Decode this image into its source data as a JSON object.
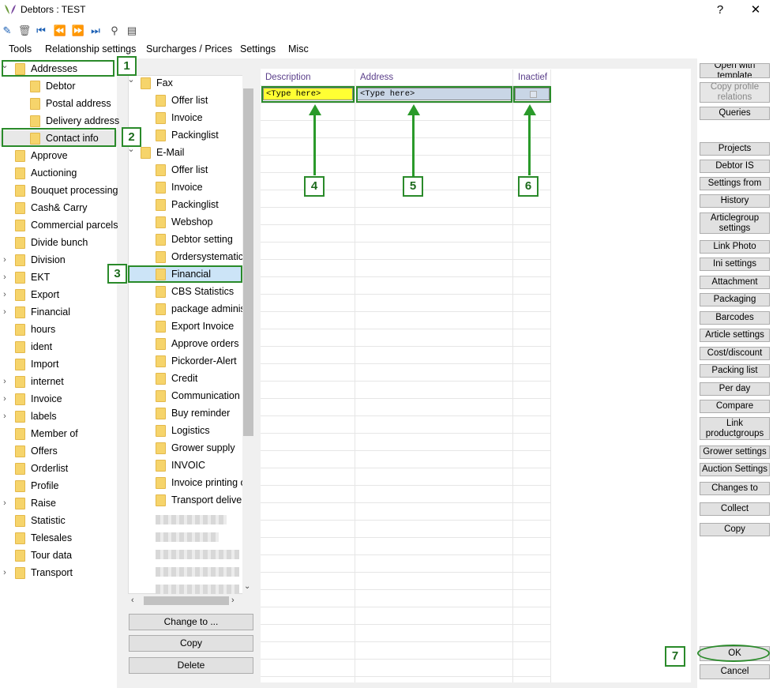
{
  "window": {
    "title": "Debtors : TEST",
    "help_label": "?",
    "close_label": "✕"
  },
  "toolbar": {
    "icons": [
      "edit-icon",
      "trash-icon",
      "first-icon",
      "prev-icon",
      "next-icon",
      "last-icon",
      "search-icon",
      "notes-icon"
    ]
  },
  "menu": [
    "Tools",
    "Relationship settings",
    "Surcharges / Prices",
    "Settings",
    "Misc"
  ],
  "left_tree": [
    {
      "label": "Addresses",
      "chev": "⌄",
      "indent": 0
    },
    {
      "label": "Debtor",
      "chev": "",
      "indent": 1
    },
    {
      "label": "Postal address",
      "chev": "",
      "indent": 1
    },
    {
      "label": "Delivery address",
      "chev": "",
      "indent": 1
    },
    {
      "label": "Contact info",
      "chev": "",
      "indent": 1
    },
    {
      "label": "Approve",
      "chev": "",
      "indent": 0
    },
    {
      "label": "Auctioning",
      "chev": "",
      "indent": 0
    },
    {
      "label": "Bouquet processing",
      "chev": "",
      "indent": 0
    },
    {
      "label": "Cash& Carry",
      "chev": "",
      "indent": 0
    },
    {
      "label": "Commercial parcels",
      "chev": "",
      "indent": 0
    },
    {
      "label": "Divide bunch",
      "chev": "",
      "indent": 0
    },
    {
      "label": "Division",
      "chev": "›",
      "indent": 0
    },
    {
      "label": "EKT",
      "chev": "›",
      "indent": 0
    },
    {
      "label": "Export",
      "chev": "›",
      "indent": 0
    },
    {
      "label": "Financial",
      "chev": "›",
      "indent": 0
    },
    {
      "label": "hours",
      "chev": "",
      "indent": 0
    },
    {
      "label": "ident",
      "chev": "",
      "indent": 0
    },
    {
      "label": "Import",
      "chev": "",
      "indent": 0
    },
    {
      "label": "internet",
      "chev": "›",
      "indent": 0
    },
    {
      "label": "Invoice",
      "chev": "›",
      "indent": 0
    },
    {
      "label": "labels",
      "chev": "›",
      "indent": 0
    },
    {
      "label": "Member of",
      "chev": "",
      "indent": 0
    },
    {
      "label": "Offers",
      "chev": "",
      "indent": 0
    },
    {
      "label": "Orderlist",
      "chev": "",
      "indent": 0
    },
    {
      "label": "Profile",
      "chev": "",
      "indent": 0
    },
    {
      "label": "Raise",
      "chev": "›",
      "indent": 0
    },
    {
      "label": "Statistic",
      "chev": "",
      "indent": 0
    },
    {
      "label": "Telesales",
      "chev": "",
      "indent": 0
    },
    {
      "label": "Tour data",
      "chev": "",
      "indent": 0
    },
    {
      "label": "Transport",
      "chev": "›",
      "indent": 0
    }
  ],
  "mid_tree": [
    {
      "label": "Fax",
      "chev": "⌄",
      "indent": 0
    },
    {
      "label": "Offer list",
      "chev": "",
      "indent": 1
    },
    {
      "label": "Invoice",
      "chev": "",
      "indent": 1
    },
    {
      "label": "Packinglist",
      "chev": "",
      "indent": 1
    },
    {
      "label": "E-Mail",
      "chev": "⌄",
      "indent": 0
    },
    {
      "label": "Offer list",
      "chev": "",
      "indent": 1
    },
    {
      "label": "Invoice",
      "chev": "",
      "indent": 1
    },
    {
      "label": "Packinglist",
      "chev": "",
      "indent": 1
    },
    {
      "label": "Webshop",
      "chev": "",
      "indent": 1
    },
    {
      "label": "Debtor setting",
      "chev": "",
      "indent": 1
    },
    {
      "label": "Ordersystematic",
      "chev": "",
      "indent": 1
    },
    {
      "label": "Financial",
      "chev": "",
      "indent": 1
    },
    {
      "label": "CBS Statistics",
      "chev": "",
      "indent": 1
    },
    {
      "label": "package adminis",
      "chev": "",
      "indent": 1
    },
    {
      "label": "Export Invoice",
      "chev": "",
      "indent": 1
    },
    {
      "label": "Approve orders",
      "chev": "",
      "indent": 1
    },
    {
      "label": "Pickorder-Alert",
      "chev": "",
      "indent": 1
    },
    {
      "label": "Credit",
      "chev": "",
      "indent": 1
    },
    {
      "label": "Communication",
      "chev": "",
      "indent": 1
    },
    {
      "label": "Buy reminder",
      "chev": "",
      "indent": 1
    },
    {
      "label": "Logistics",
      "chev": "",
      "indent": 1
    },
    {
      "label": "Grower supply",
      "chev": "",
      "indent": 1
    },
    {
      "label": "INVOIC",
      "chev": "",
      "indent": 1
    },
    {
      "label": "Invoice printing o",
      "chev": "",
      "indent": 1
    },
    {
      "label": "Transport deliver",
      "chev": "",
      "indent": 1
    }
  ],
  "mid_buttons": {
    "change": "Change to ...",
    "copy": "Copy",
    "delete": "Delete"
  },
  "grid": {
    "columns": [
      "Description",
      "Address",
      "Inactief"
    ],
    "row1": {
      "description": "<Type here>",
      "address": "<Type here>"
    }
  },
  "right_buttons": [
    "Open with template",
    "Copy profile relations",
    "Queries",
    "Projects",
    "Debtor IS",
    "Settings from",
    "History",
    "Articlegroup settings",
    "Link Photo",
    "Ini settings",
    "Attachment",
    "Packaging",
    "Barcodes",
    "Article settings",
    "Cost/discount",
    "Packing list",
    "Per day",
    "Compare",
    "Link productgroups",
    "Grower settings",
    "Auction Settings",
    "Changes to",
    "Collect",
    "Copy"
  ],
  "ok_label": "OK",
  "cancel_label": "Cancel",
  "markers": [
    "1",
    "2",
    "3",
    "4",
    "5",
    "6",
    "7"
  ],
  "colors": {
    "accent_green": "#2a8a2a",
    "highlight_yellow": "#ffff33",
    "selection_blue": "#cce4f7"
  }
}
